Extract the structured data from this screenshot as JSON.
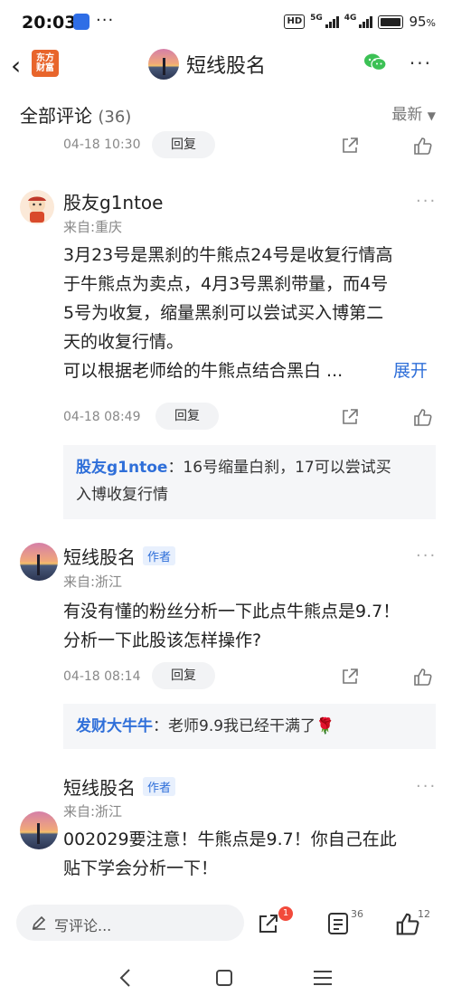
{
  "status_bar": {
    "time": "20:03",
    "dots": "···",
    "hd": "HD",
    "net1": "5G",
    "net2": "4G",
    "battery": "95",
    "battery_unit": "%"
  },
  "nav": {
    "logo_line1": "东方",
    "logo_line2": "财富",
    "title": "短线股名"
  },
  "header": {
    "title": "全部评论",
    "count": "(36)",
    "sort_label": "最新"
  },
  "top_partial": {
    "time": "04-18 10:30",
    "reply_label": "回复"
  },
  "comments": [
    {
      "name": "股友g1ntoe",
      "from": "来自:重庆",
      "lines": [
        "3月23号是黑刹的牛熊点24号是收复行情高",
        "于牛熊点为卖点，4月3号黑刹带量，而4号",
        "5号为收复，缩量黑刹可以尝试买入博第二",
        "天的收复行情。",
        "可以根据老师给的牛熊点结合黑白 ..."
      ],
      "expand": "展开",
      "time": "04-18 08:49",
      "reply_label": "回复",
      "reply": {
        "name": "股友g1ntoe",
        "text1": "：16号缩量白刹，17可以尝试买",
        "text2": "入博收复行情"
      }
    },
    {
      "name": "短线股名",
      "tag": "作者",
      "from": "来自:浙江",
      "lines": [
        "有没有懂的粉丝分析一下此点牛熊点是9.7！",
        "分析一下此股该怎样操作?"
      ],
      "time": "04-18 08:14",
      "reply_label": "回复",
      "reply": {
        "name": "发财大牛牛",
        "text1": "：老师9.9我已经干满了🌹"
      }
    },
    {
      "name": "短线股名",
      "tag": "作者",
      "from": "来自:浙江",
      "lines": [
        "002029要注意！牛熊点是9.7！你自己在此",
        "贴下学会分析一下！"
      ]
    }
  ],
  "bottom_bar": {
    "placeholder": "写评论...",
    "share_badge": "1",
    "comment_count": "36",
    "like_count": "12"
  },
  "colors": {
    "accent": "#2f6fd9",
    "badge": "#f24a3b",
    "logo": "#e8652b"
  }
}
